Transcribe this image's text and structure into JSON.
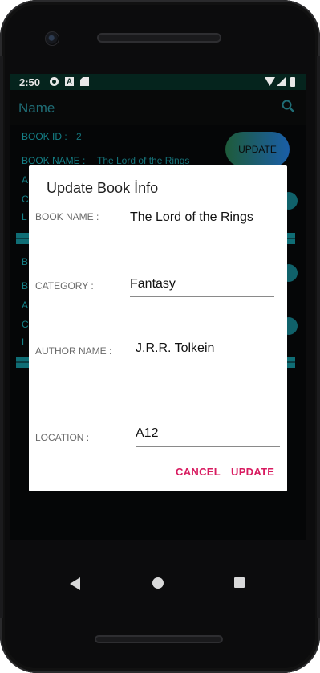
{
  "status_bar": {
    "time": "2:50",
    "a_icon": "A"
  },
  "app_bar": {
    "title": "Name"
  },
  "background_list": {
    "book_id_label": "BOOK ID :",
    "book_id_value": "2",
    "book_name_label": "BOOK NAME :",
    "book_name_value": "The Lord of the Rings",
    "update_button": "UPDATE",
    "truncated_labels": [
      "A",
      "C",
      "L",
      "B",
      "B",
      "A",
      "C",
      "L"
    ]
  },
  "dialog": {
    "title": "Update Book İnfo",
    "fields": {
      "book_name": {
        "label": "BOOK NAME :",
        "value": "The Lord of the Rings"
      },
      "category": {
        "label": "CATEGORY :",
        "value": "Fantasy"
      },
      "author_name": {
        "label": "AUTHOR NAME :",
        "value": "J.R.R. Tolkein"
      },
      "location": {
        "label": "LOCATION :",
        "value": "A12"
      }
    },
    "cancel_label": "CANCEL",
    "update_label": "UPDATE"
  },
  "colors": {
    "accent": "#d81b60",
    "teal": "#147f86",
    "status_bar": "#05241d"
  },
  "icons": {
    "settings": "gear-icon",
    "search": "search-icon",
    "wifi": "wifi-icon",
    "signal": "signal-icon",
    "battery": "battery-icon",
    "back": "back-icon",
    "home": "home-icon",
    "recents": "recents-icon"
  }
}
